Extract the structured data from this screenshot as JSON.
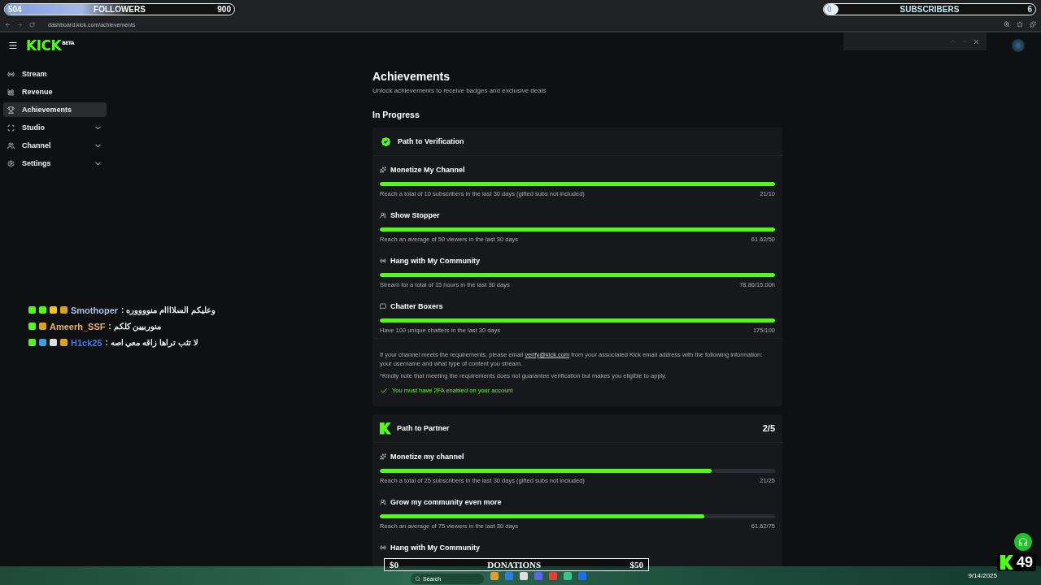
{
  "overlay": {
    "followers": {
      "current": "504",
      "label": "FOLLOWERS",
      "goal": "900",
      "level": 0.56
    },
    "subscribers": {
      "current": "0",
      "label": "SUBSCRIBERS",
      "goal": "6",
      "level": 0.03
    }
  },
  "browser": {
    "url": "dashboard.kick.com/achievements"
  },
  "header": {
    "logo": "KICK",
    "logo_tag": "BETA"
  },
  "sidebar": {
    "items": [
      {
        "label": "Stream",
        "selected": false,
        "expandable": false
      },
      {
        "label": "Revenue",
        "selected": false,
        "expandable": false
      },
      {
        "label": "Achievements",
        "selected": true,
        "expandable": false
      },
      {
        "label": "Studio",
        "selected": false,
        "expandable": true
      },
      {
        "label": "Channel",
        "selected": false,
        "expandable": true
      },
      {
        "label": "Settings",
        "selected": false,
        "expandable": true
      }
    ]
  },
  "page": {
    "title": "Achievements",
    "subtitle": "Unlock achievements to receive badges and exclusive deals",
    "section": "In Progress",
    "cards": [
      {
        "kind": "verification",
        "title": "Path to Verification",
        "items": [
          {
            "title": "Monetize My Channel",
            "description": "Reach a total of 10 subscribers in the last 30 days (gifted subs not included)",
            "reading": "21/10",
            "level": 1
          },
          {
            "title": "Show Stopper",
            "description": "Reach an average of 50 viewers in the last 30 days",
            "reading": "61.62/50",
            "level": 1
          },
          {
            "title": "Hang with My Community",
            "description": "Stream for a total of 15 hours in the last 30 days",
            "reading": "78.86/15.00h",
            "level": 1
          },
          {
            "title": "Chatter Boxers",
            "description": "Have 100 unique chatters in the last 30 days",
            "reading": "175/100",
            "level": 1
          }
        ],
        "note": "If your channel meets the requirements, please email",
        "note_link": "verify@kick.com",
        "note_end": "from your associated Kick email address with the following information: your username and what type of content you stream.",
        "disclaimer": "*Kindly note that meeting the requirements does not guarantee verification but makes you eligible to apply.",
        "requirement": {
          "text": "You must have 2FA enabled on your account",
          "met": true
        }
      },
      {
        "kind": "partner",
        "title": "Path to Partner",
        "count": "2/5",
        "items": [
          {
            "title": "Monetize my channel",
            "description": "Reach a total of 25 subscribers in the last 30 days (gifted subs not included)",
            "reading": "21/25",
            "level": 0.84
          },
          {
            "title": "Grow my community even more",
            "description": "Reach an average of 75 viewers in the last 30 days",
            "reading": "61.62/75",
            "level": 0.82
          },
          {
            "title": "Hang with My Community"
          }
        ]
      }
    ]
  },
  "chat": [
    {
      "username": "Smothoper",
      "color": "#a9c1e6",
      "separator": ":",
      "message": "وعليكم السلاااام منووووره"
    },
    {
      "username": "Ameerh_SSF",
      "color": "#e8b06a",
      "separator": ":",
      "message": "منوربيين كلكم"
    },
    {
      "username": "H1ck25",
      "color": "#3f7fe0",
      "separator": ":",
      "message": "لا تثب تراها زاقه معي اصه"
    }
  ],
  "donations": {
    "min": "$0",
    "label": "DONATIONS",
    "max": "$50"
  },
  "kick_counter": "49",
  "taskbar": {
    "search_placeholder": "Search",
    "date": "9/14/2025"
  }
}
